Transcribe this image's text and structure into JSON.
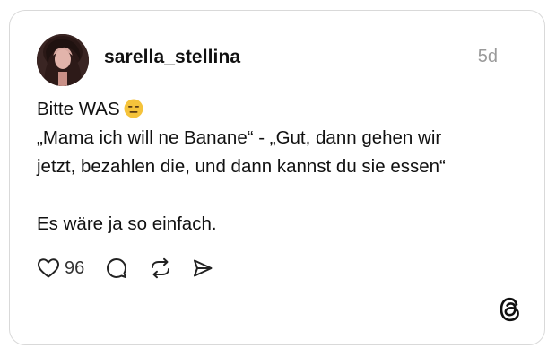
{
  "post": {
    "username": "sarella_stellina",
    "time": "5d",
    "text_lines": [
      "Bitte WAS",
      "„Mama ich will ne Banane“ - „Gut, dann gehen wir",
      "jetzt, bezahlen die, und dann kannst du sie essen“",
      "",
      "Es wäre ja so einfach."
    ],
    "emoji": "expressionless-face"
  },
  "actions": {
    "like_count": "96",
    "icons": [
      "heart-icon",
      "comment-icon",
      "repost-icon",
      "share-icon"
    ]
  },
  "brand": {
    "icon": "threads-logo"
  },
  "colors": {
    "text": "#111111",
    "muted": "#9a9a9a",
    "border": "#d9d9d9",
    "emoji": "#f5c33b"
  }
}
